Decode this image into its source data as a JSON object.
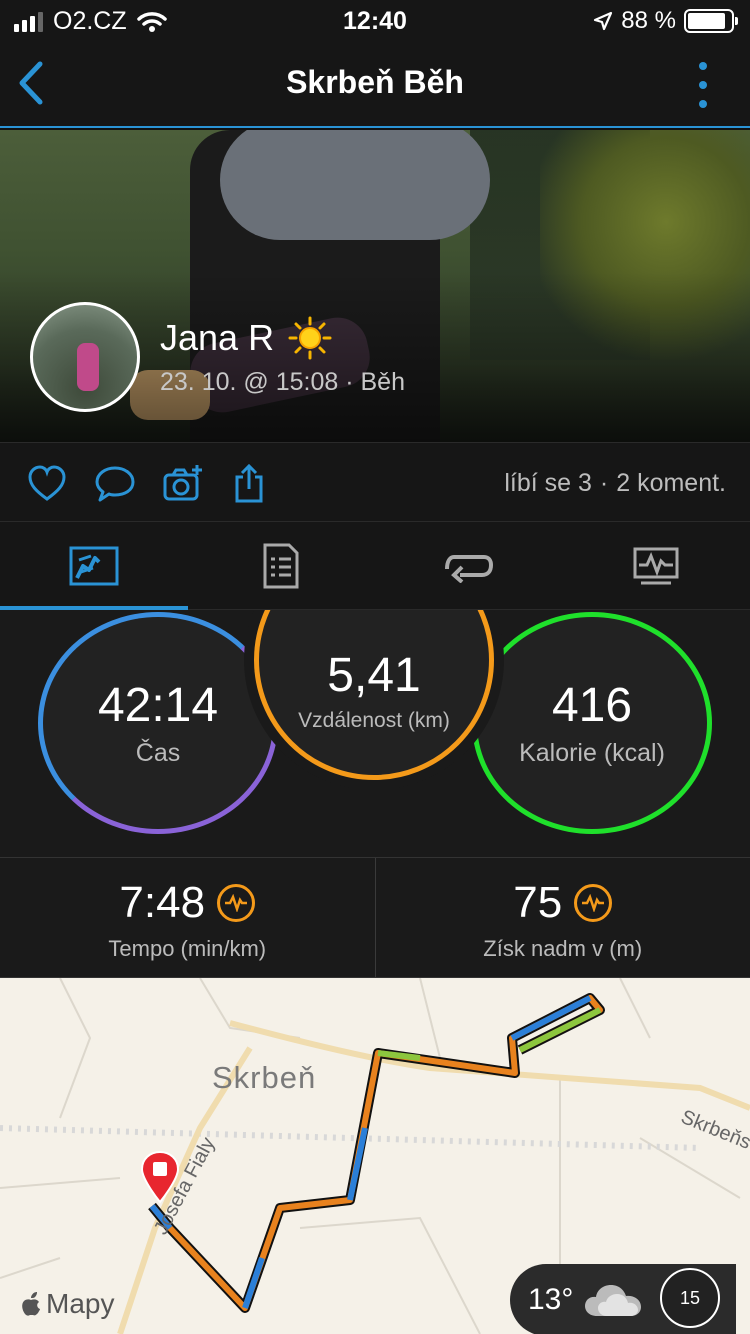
{
  "status": {
    "carrier": "O2.CZ",
    "time": "12:40",
    "battery_pct": "88 %",
    "battery_level": 0.88
  },
  "nav": {
    "title": "Skrbeň Běh"
  },
  "activity": {
    "user_name": "Jana R",
    "meta": "23. 10. @ 15:08 · Běh",
    "weather_icon": "sun-icon"
  },
  "social": {
    "likes": "líbí se 3",
    "separator": "·",
    "comments": "2 koment."
  },
  "tabs": [
    {
      "name": "summary",
      "icon": "summary-chart-icon",
      "active": true
    },
    {
      "name": "details",
      "icon": "details-list-icon",
      "active": false
    },
    {
      "name": "laps",
      "icon": "laps-loop-icon",
      "active": false
    },
    {
      "name": "charts",
      "icon": "charts-icon",
      "active": false
    }
  ],
  "stats": {
    "time": {
      "value": "42:14",
      "label": "Čas"
    },
    "distance": {
      "value": "5,41",
      "label": "Vzdálenost (km)"
    },
    "calories": {
      "value": "416",
      "label": "Kalorie (kcal)"
    }
  },
  "metrics": {
    "pace": {
      "value": "7:48",
      "label": "Tempo (min/km)"
    },
    "elevation": {
      "value": "75",
      "label": "Získ nadm v (m)"
    }
  },
  "map": {
    "town": "Skrbeň",
    "road_east": "Skrbeňs",
    "road_west": "Josefa Fialy",
    "provider": "Mapy",
    "temperature": "13°",
    "compass": "15"
  },
  "colors": {
    "accent": "#2a93d5",
    "time_ring_top": "#3b8fe0",
    "time_ring_bottom": "#8a63d8",
    "distance_ring": "#f49a1a",
    "calories_ring": "#1fe02b",
    "pin": "#e8262f"
  }
}
